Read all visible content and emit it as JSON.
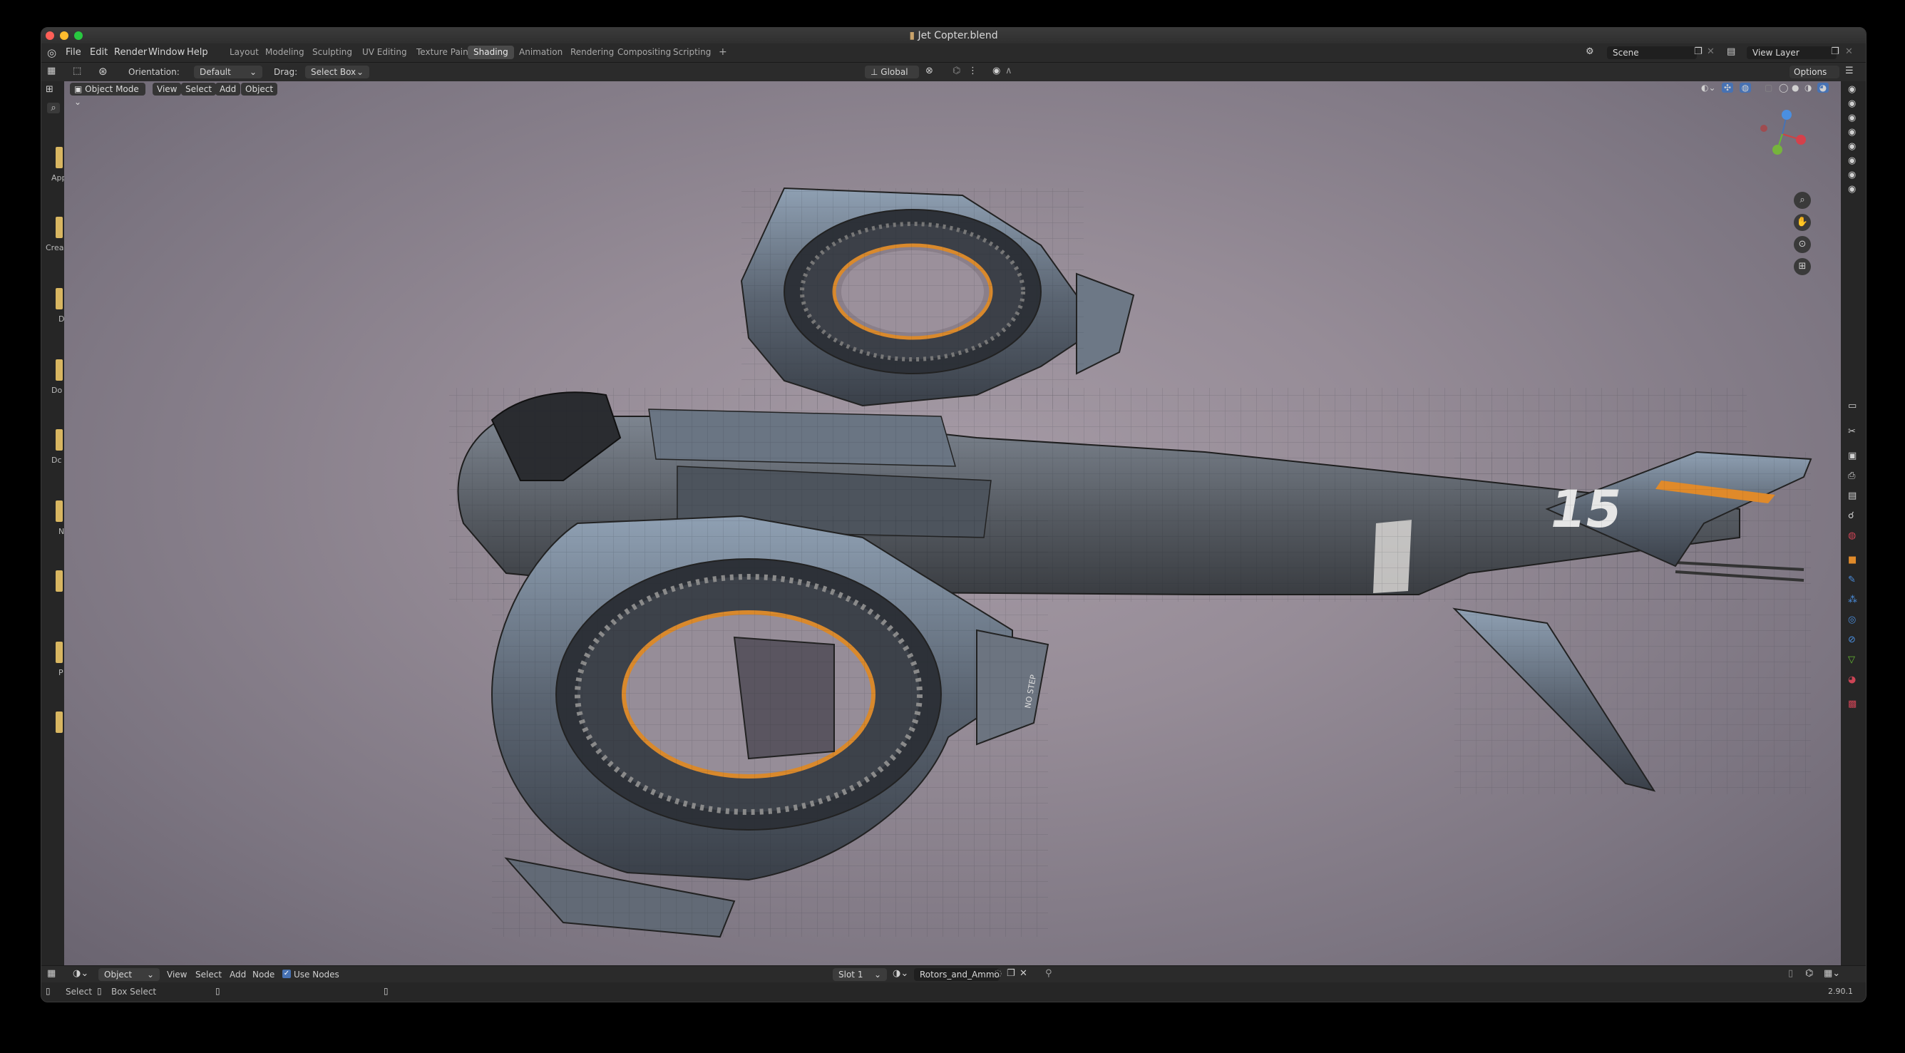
{
  "window": {
    "title": "Jet Copter.blend"
  },
  "menu": [
    "File",
    "Edit",
    "Render",
    "Window",
    "Help"
  ],
  "workspaces": [
    {
      "label": "Layout",
      "active": false
    },
    {
      "label": "Modeling",
      "active": false
    },
    {
      "label": "Sculpting",
      "active": false
    },
    {
      "label": "UV Editing",
      "active": false
    },
    {
      "label": "Texture Paint",
      "active": false
    },
    {
      "label": "Shading",
      "active": true
    },
    {
      "label": "Animation",
      "active": false
    },
    {
      "label": "Rendering",
      "active": false
    },
    {
      "label": "Compositing",
      "active": false
    },
    {
      "label": "Scripting",
      "active": false
    }
  ],
  "scene": {
    "name": "Scene",
    "view_layer": "View Layer"
  },
  "toolbar": {
    "orientation_label": "Orientation:",
    "orientation_value": "Default",
    "drag_label": "Drag:",
    "drag_value": "Select Box",
    "transform_orientation": "Global",
    "options_label": "Options"
  },
  "viewport_header": {
    "mode": "Object Mode",
    "buttons": [
      "View",
      "Select",
      "Add",
      "Object"
    ]
  },
  "asset_sidebar_labels": [
    "App",
    "Crea",
    "D",
    "Do",
    "Dc",
    "N",
    "P"
  ],
  "aircraft": {
    "tail_number": "15",
    "panel_marking": "NO STEP"
  },
  "node_header": {
    "object": "Object",
    "buttons": [
      "View",
      "Select",
      "Add",
      "Node"
    ],
    "use_nodes_label": "Use Nodes",
    "use_nodes_checked": true,
    "slot": "Slot 1",
    "material": "Rotors_and_Ammo"
  },
  "status": {
    "select": "Select",
    "box_select": "Box Select",
    "version": "2.90.1"
  },
  "colors": {
    "accent_blue": "#4772b3",
    "folder_yellow": "#d8b661",
    "stripe_orange": "#e08a2a"
  }
}
